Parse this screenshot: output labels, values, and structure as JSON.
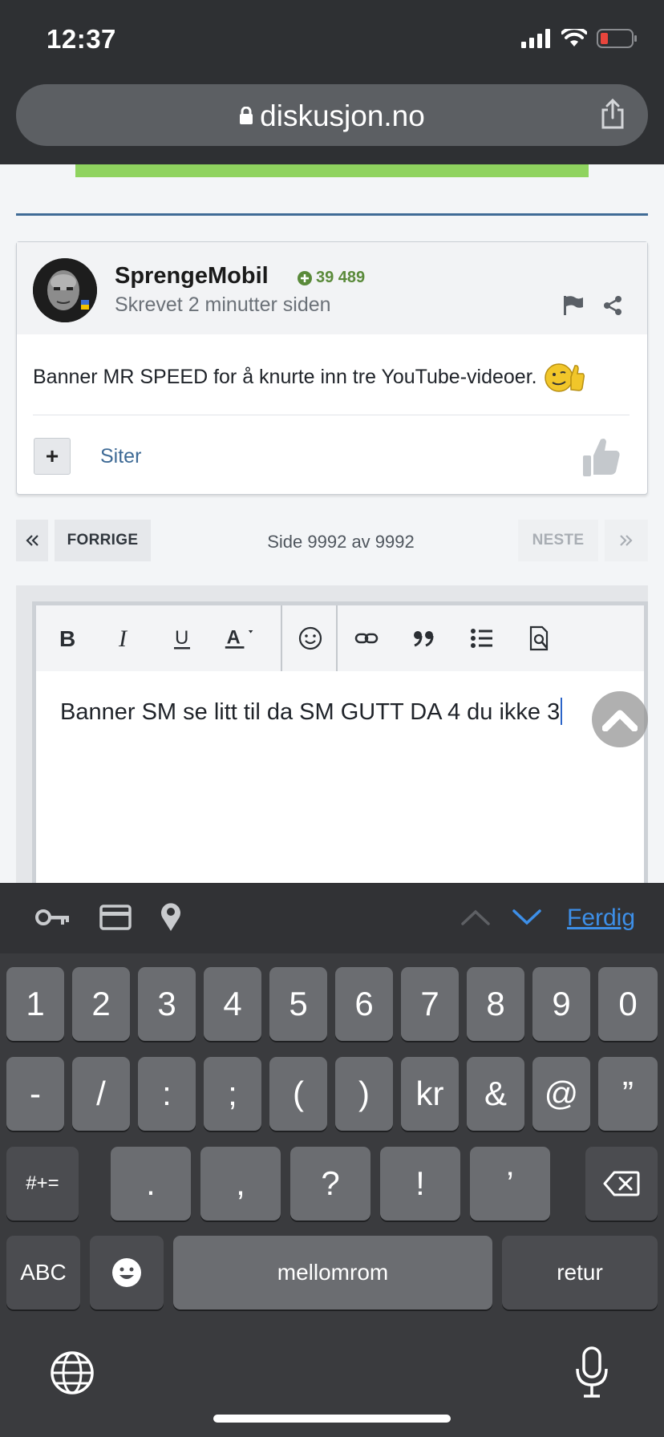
{
  "status_bar": {
    "time": "12:37"
  },
  "browser": {
    "url": "diskusjon.no"
  },
  "post": {
    "author": "SprengeMobil",
    "reputation": "39 489",
    "posted": "Skrevet 2 minutter siden",
    "body": "Banner MR SPEED for å knurte inn tre YouTube-videoer.",
    "quote_label": "Siter"
  },
  "pagination": {
    "prev_label": "FORRIGE",
    "info": "Side 9992 av 9992",
    "next_label": "NESTE"
  },
  "editor": {
    "text": "Banner SM se litt til da SM GUTT DA 4 du ikke 3",
    "toolbar": [
      "bold-icon",
      "italic-icon",
      "underline-icon",
      "text-color-icon",
      "emoji-icon",
      "link-icon",
      "quote-icon",
      "list-icon",
      "preview-icon"
    ]
  },
  "keyboard": {
    "done_label": "Ferdig",
    "row1": [
      "1",
      "2",
      "3",
      "4",
      "5",
      "6",
      "7",
      "8",
      "9",
      "0"
    ],
    "row2": [
      "-",
      "/",
      ":",
      ";",
      "(",
      ")",
      "kr",
      "&",
      "@",
      "”"
    ],
    "row3_mode": "#+=",
    "row3": [
      ".",
      ",",
      "?",
      "!",
      "’"
    ],
    "abc_label": "ABC",
    "space_label": "mellomrom",
    "return_label": "retur"
  },
  "colors": {
    "accent_blue": "#3f6b96",
    "reputation_green": "#5a8a3a",
    "keyboard_link": "#3d8fe8",
    "progress_green": "#8fd35f"
  }
}
